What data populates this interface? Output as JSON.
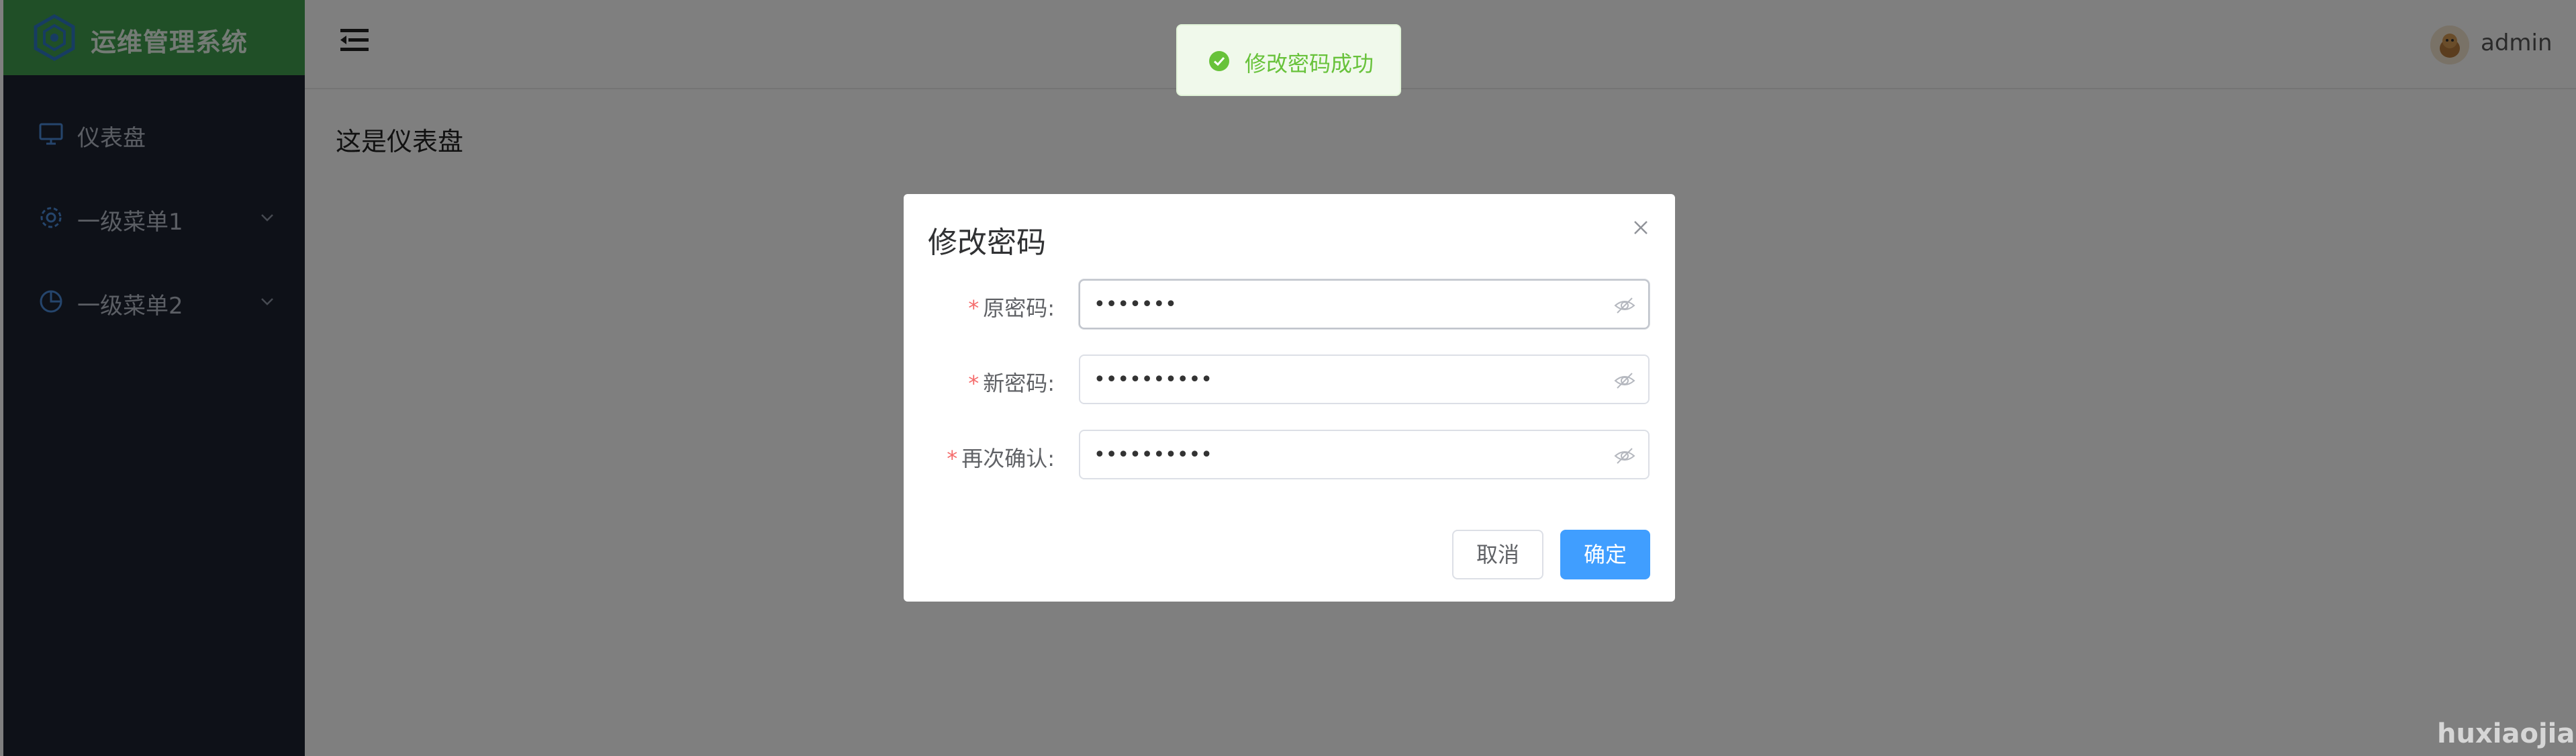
{
  "app": {
    "title": "运维管理系统"
  },
  "sidebar": {
    "items": [
      {
        "label": "仪表盘",
        "icon": "monitor-icon"
      },
      {
        "label": "一级菜单1",
        "icon": "gear-icon",
        "expandable": true
      },
      {
        "label": "一级菜单2",
        "icon": "pie-chart-icon",
        "expandable": true
      }
    ]
  },
  "header": {
    "username": "admin",
    "collapse_icon": "menu-fold-icon"
  },
  "main": {
    "text": "这是仪表盘"
  },
  "toast": {
    "text": "修改密码成功",
    "type": "success",
    "icon": "check-circle-icon"
  },
  "dialog": {
    "title": "修改密码",
    "fields": [
      {
        "label": "原密码:",
        "required": true,
        "value": "•••••••"
      },
      {
        "label": "新密码:",
        "required": true,
        "value": "••••••••••"
      },
      {
        "label": "再次确认:",
        "required": true,
        "value": "••••••••••"
      }
    ],
    "cancel_label": "取消",
    "confirm_label": "确定"
  },
  "watermark": "huxiaojian",
  "colors": {
    "sidebar_bg": "#1d2331",
    "logo_bg": "#409e4f",
    "primary": "#409eff",
    "success": "#67c23a",
    "required": "#f56c6c"
  }
}
